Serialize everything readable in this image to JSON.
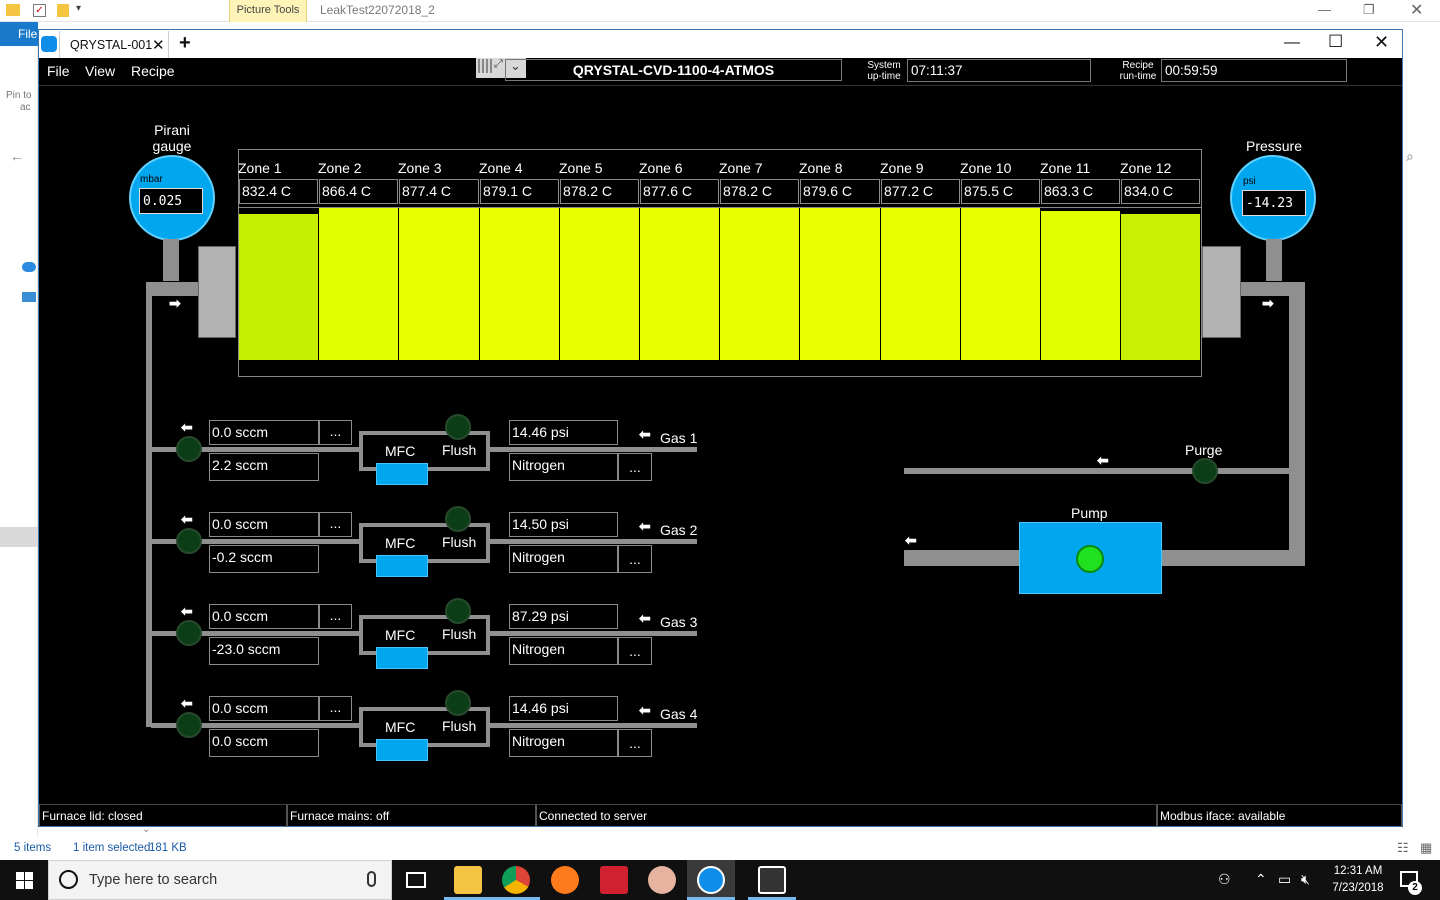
{
  "explorer": {
    "picture_tools": "Picture Tools",
    "title": "LeakTest22072018_2",
    "file_tab": "File",
    "pin_to": "Pin to",
    "pin_to2": "ac",
    "status_items": "5 items",
    "status_selected": "1 item selected",
    "status_size": "181 KB"
  },
  "taskbar": {
    "search_placeholder": "Type here to search",
    "time": "12:31 AM",
    "date": "7/23/2018",
    "notifications": "2"
  },
  "app": {
    "tab_title": "QRYSTAL-001",
    "menu": {
      "file": "File",
      "view": "View",
      "recipe": "Recipe"
    },
    "machine_name": "QRYSTAL-CVD-1100-4-ATMOS",
    "system_label_1": "System",
    "system_label_2": "up-time",
    "system_uptime": "07:11:37",
    "recipe_label_1": "Recipe",
    "recipe_label_2": "run-time",
    "recipe_runtime": "00:59:59",
    "pirani_label_1": "Pirani",
    "pirani_label_2": "gauge",
    "pirani_unit": "mbar",
    "pirani_value": "0.025",
    "pressure_label": "Pressure",
    "pressure_unit": "psi",
    "pressure_value": "-14.23",
    "zones": [
      {
        "name": "Zone 1",
        "temp": "832.4 C",
        "color": "#c6f000"
      },
      {
        "name": "Zone 2",
        "temp": "866.4 C",
        "color": "#e2ff00"
      },
      {
        "name": "Zone 3",
        "temp": "877.4 C",
        "color": "#e8ff00"
      },
      {
        "name": "Zone 4",
        "temp": "879.1 C",
        "color": "#eaff00"
      },
      {
        "name": "Zone 5",
        "temp": "878.2 C",
        "color": "#e9ff00"
      },
      {
        "name": "Zone 6",
        "temp": "877.6 C",
        "color": "#e9ff00"
      },
      {
        "name": "Zone 7",
        "temp": "878.2 C",
        "color": "#e9ff00"
      },
      {
        "name": "Zone 8",
        "temp": "879.6 C",
        "color": "#eaff00"
      },
      {
        "name": "Zone 9",
        "temp": "877.2 C",
        "color": "#e8ff00"
      },
      {
        "name": "Zone 10",
        "temp": "875.5 C",
        "color": "#e8ff00"
      },
      {
        "name": "Zone 11",
        "temp": "863.3 C",
        "color": "#e2ff00"
      },
      {
        "name": "Zone 12",
        "temp": "834.0 C",
        "color": "#c8f000"
      }
    ],
    "gas_lines": [
      {
        "setpoint": "0.0 sccm",
        "actual": "2.2 sccm",
        "pressure": "14.46 psi",
        "gas": "Nitrogen",
        "name": "Gas 1",
        "mfc": "MFC",
        "flush": "Flush",
        "more": "..."
      },
      {
        "setpoint": "0.0 sccm",
        "actual": "-0.2 sccm",
        "pressure": "14.50 psi",
        "gas": "Nitrogen",
        "name": "Gas 2",
        "mfc": "MFC",
        "flush": "Flush",
        "more": "..."
      },
      {
        "setpoint": "0.0 sccm",
        "actual": "-23.0 sccm",
        "pressure": "87.29 psi",
        "gas": "Nitrogen",
        "name": "Gas 3",
        "mfc": "MFC",
        "flush": "Flush",
        "more": "..."
      },
      {
        "setpoint": "0.0 sccm",
        "actual": "0.0 sccm",
        "pressure": "14.46 psi",
        "gas": "Nitrogen",
        "name": "Gas 4",
        "mfc": "MFC",
        "flush": "Flush",
        "more": "..."
      }
    ],
    "purge_label": "Purge",
    "pump_label": "Pump",
    "status": {
      "lid": "Furnace lid: closed",
      "mains": "Furnace mains: off",
      "server": "Connected to server",
      "modbus": "Modbus iface: available"
    }
  }
}
